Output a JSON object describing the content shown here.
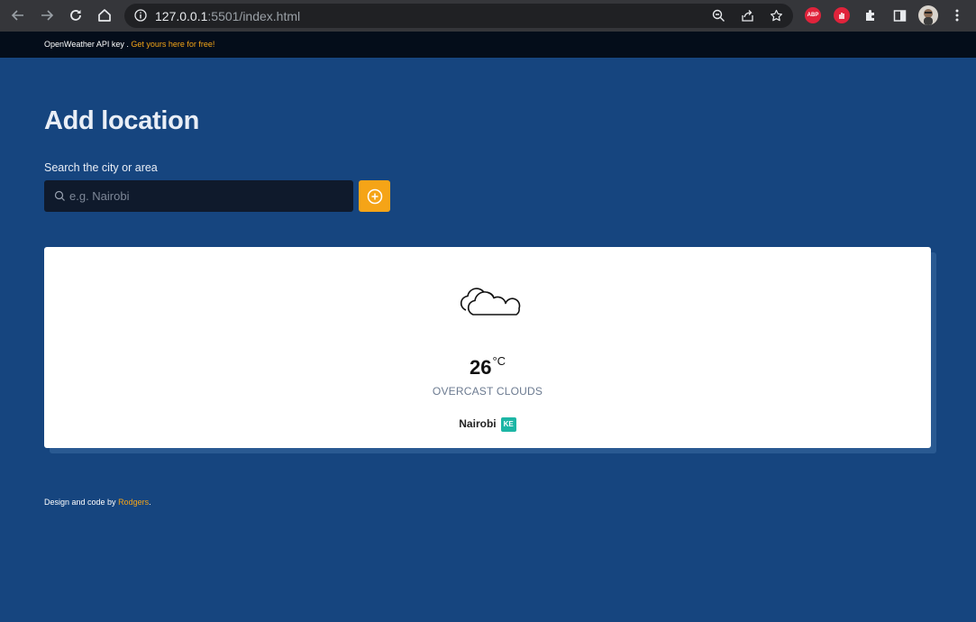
{
  "browser": {
    "url_host": "127.0.0.1",
    "url_rest": ":5501/index.html",
    "extensions": [
      "abp-icon",
      "stop-icon",
      "puzzle-icon",
      "sidepanel-icon"
    ],
    "abp_label": "ABP"
  },
  "topbar": {
    "label": "OpenWeather API key . ",
    "link": "Get yours here for free!"
  },
  "main": {
    "title": "Add location",
    "search_label": "Search the city or area",
    "search_placeholder": "e.g. Nairobi"
  },
  "weather": {
    "icon": "overcast-clouds-icon",
    "temperature": "26",
    "unit": "°C",
    "description": "OVERCAST CLOUDS",
    "city": "Nairobi",
    "country": "KE"
  },
  "footer": {
    "text": "Design and code by ",
    "author": "Rodgers",
    "suffix": "."
  },
  "colors": {
    "background": "#16457f",
    "topbar": "#040d1a",
    "accent": "#f5a417",
    "badge": "#1db6a5"
  }
}
